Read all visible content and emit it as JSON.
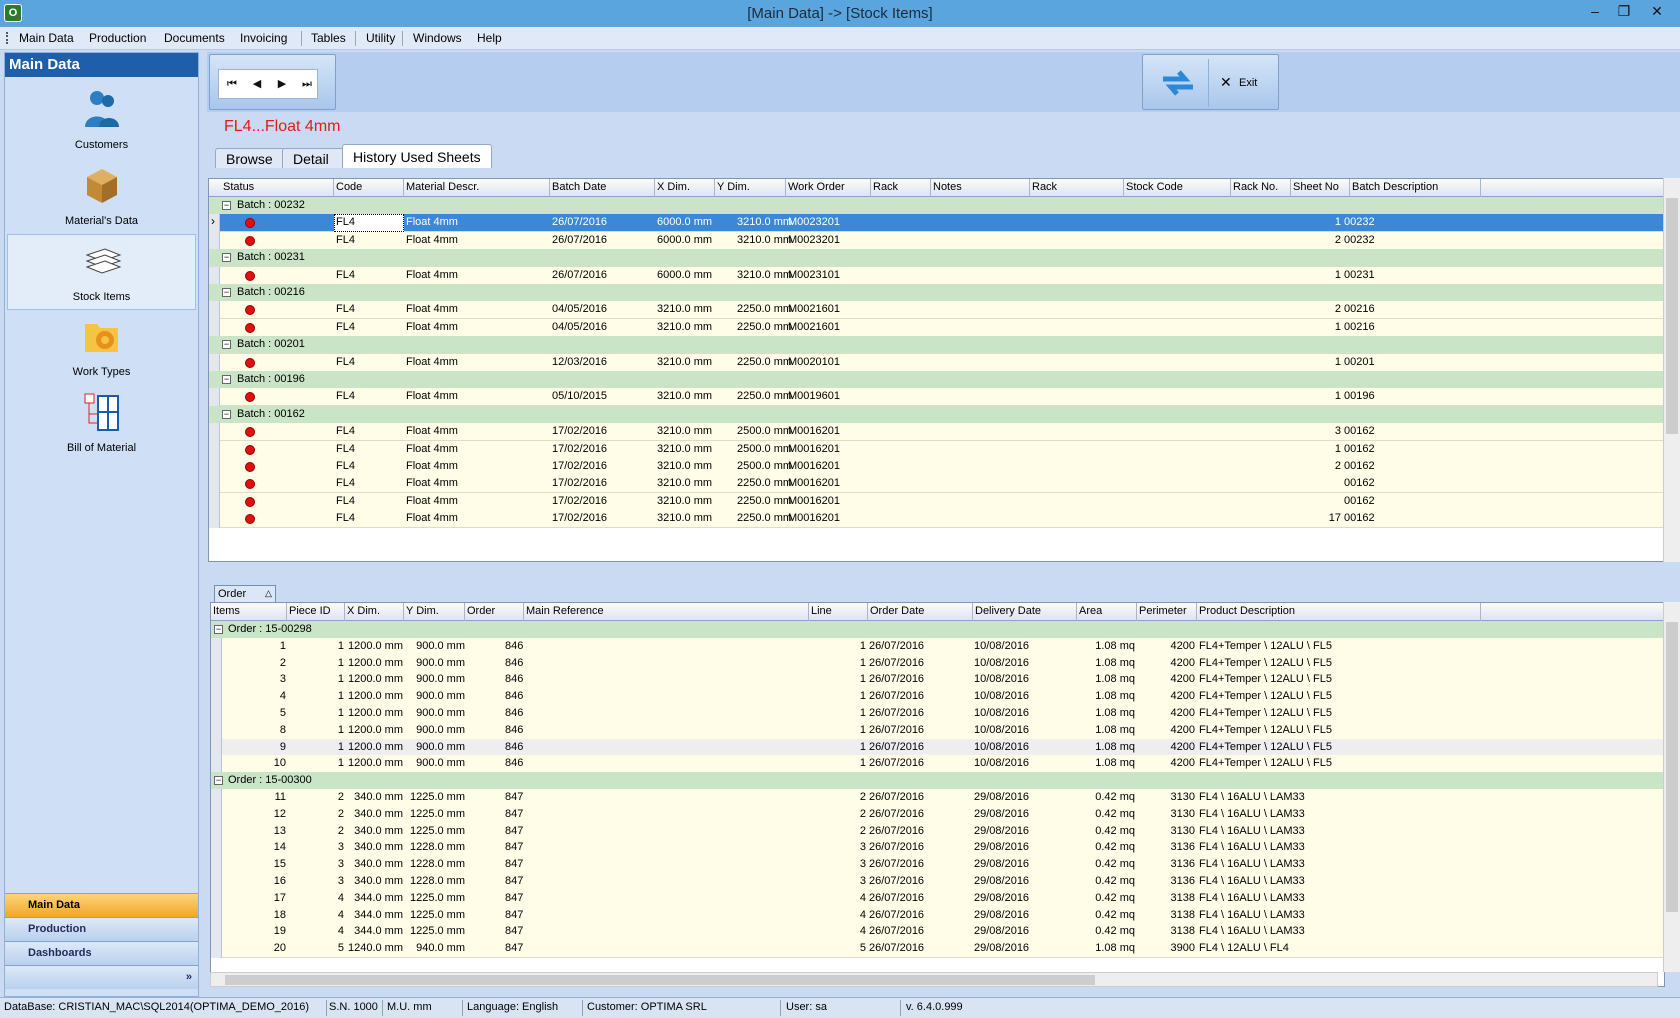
{
  "window": {
    "title": "[Main Data] -> [Stock Items]",
    "app_icon": "optima-app-icon"
  },
  "menu": [
    "Main Data",
    "Production",
    "Documents",
    "Invoicing",
    "Tables",
    "Utility",
    "Windows",
    "Help"
  ],
  "sidebar": {
    "header": "Main Data",
    "items": [
      {
        "label": "Customers",
        "icon": "customers-icon"
      },
      {
        "label": "Material's Data",
        "icon": "box-icon"
      },
      {
        "label": "Stock Items",
        "icon": "sheets-stack-icon"
      },
      {
        "label": "Work Types",
        "icon": "gear-folder-icon"
      },
      {
        "label": "Bill of Material",
        "icon": "bill-of-material-icon"
      }
    ],
    "bottom_tabs": [
      "Main Data",
      "Production",
      "Dashboards"
    ],
    "expand_glyph": "»"
  },
  "toolbar": {
    "exit_label": "Exit"
  },
  "record_title": "FL4...Float 4mm",
  "tabs": [
    "Browse",
    "Detail",
    "History Used Sheets"
  ],
  "grid1": {
    "columns": [
      "Status",
      "Code",
      "Material Descr.",
      "Batch Date",
      "X Dim.",
      "Y Dim.",
      "Work Order",
      "Rack",
      "Notes",
      "Rack",
      "Stock Code",
      "Rack No.",
      "Sheet No",
      "Batch Description"
    ],
    "rows": [
      {
        "group": "Batch : 00232"
      },
      {
        "code": "FL4",
        "descr": "Float 4mm",
        "date": "26/07/2016",
        "x": "6000.0 mm",
        "y": "3210.0 mm",
        "wo": "M0023201",
        "sheet": "1",
        "batch": "00232",
        "selected": true
      },
      {
        "code": "FL4",
        "descr": "Float 4mm",
        "date": "26/07/2016",
        "x": "6000.0 mm",
        "y": "3210.0 mm",
        "wo": "M0023201",
        "sheet": "2",
        "batch": "00232"
      },
      {
        "group": "Batch : 00231"
      },
      {
        "code": "FL4",
        "descr": "Float 4mm",
        "date": "26/07/2016",
        "x": "6000.0 mm",
        "y": "3210.0 mm",
        "wo": "M0023101",
        "sheet": "1",
        "batch": "00231"
      },
      {
        "group": "Batch : 00216"
      },
      {
        "code": "FL4",
        "descr": "Float 4mm",
        "date": "04/05/2016",
        "x": "3210.0 mm",
        "y": "2250.0 mm",
        "wo": "M0021601",
        "sheet": "2",
        "batch": "00216"
      },
      {
        "code": "FL4",
        "descr": "Float 4mm",
        "date": "04/05/2016",
        "x": "3210.0 mm",
        "y": "2250.0 mm",
        "wo": "M0021601",
        "sheet": "1",
        "batch": "00216"
      },
      {
        "group": "Batch : 00201"
      },
      {
        "code": "FL4",
        "descr": "Float 4mm",
        "date": "12/03/2016",
        "x": "3210.0 mm",
        "y": "2250.0 mm",
        "wo": "M0020101",
        "sheet": "1",
        "batch": "00201"
      },
      {
        "group": "Batch : 00196"
      },
      {
        "code": "FL4",
        "descr": "Float 4mm",
        "date": "05/10/2015",
        "x": "3210.0 mm",
        "y": "2250.0 mm",
        "wo": "M0019601",
        "sheet": "1",
        "batch": "00196"
      },
      {
        "group": "Batch : 00162"
      },
      {
        "code": "FL4",
        "descr": "Float 4mm",
        "date": "17/02/2016",
        "x": "3210.0 mm",
        "y": "2500.0 mm",
        "wo": "M0016201",
        "sheet": "3",
        "batch": "00162"
      },
      {
        "code": "FL4",
        "descr": "Float 4mm",
        "date": "17/02/2016",
        "x": "3210.0 mm",
        "y": "2500.0 mm",
        "wo": "M0016201",
        "sheet": "1",
        "batch": "00162"
      },
      {
        "code": "FL4",
        "descr": "Float 4mm",
        "date": "17/02/2016",
        "x": "3210.0 mm",
        "y": "2500.0 mm",
        "wo": "M0016201",
        "sheet": "2",
        "batch": "00162"
      },
      {
        "code": "FL4",
        "descr": "Float 4mm",
        "date": "17/02/2016",
        "x": "3210.0 mm",
        "y": "2250.0 mm",
        "wo": "M0016201",
        "sheet": "",
        "batch": "00162"
      },
      {
        "code": "FL4",
        "descr": "Float 4mm",
        "date": "17/02/2016",
        "x": "3210.0 mm",
        "y": "2250.0 mm",
        "wo": "M0016201",
        "sheet": "",
        "batch": "00162"
      },
      {
        "code": "FL4",
        "descr": "Float 4mm",
        "date": "17/02/2016",
        "x": "3210.0 mm",
        "y": "2250.0 mm",
        "wo": "M0016201",
        "sheet": "17",
        "batch": "00162"
      }
    ]
  },
  "group_by": "Order",
  "grid2": {
    "columns": [
      "Items",
      "Piece ID",
      "X Dim.",
      "Y Dim.",
      "Order",
      "Main Reference",
      "Line",
      "Order Date",
      "Delivery Date",
      "Area",
      "Perimeter",
      "Product Description"
    ],
    "rows": [
      {
        "group": "Order : 15-00298"
      },
      {
        "item": "1",
        "piece": "1",
        "x": "1200.0 mm",
        "y": "900.0 mm",
        "order": "846",
        "line": "1",
        "odate": "26/07/2016",
        "ddate": "10/08/2016",
        "area": "1.08 mq",
        "perim": "4200",
        "prod": "FL4+Temper \\ 12ALU \\ FL5"
      },
      {
        "item": "2",
        "piece": "1",
        "x": "1200.0 mm",
        "y": "900.0 mm",
        "order": "846",
        "line": "1",
        "odate": "26/07/2016",
        "ddate": "10/08/2016",
        "area": "1.08 mq",
        "perim": "4200",
        "prod": "FL4+Temper \\ 12ALU \\ FL5"
      },
      {
        "item": "3",
        "piece": "1",
        "x": "1200.0 mm",
        "y": "900.0 mm",
        "order": "846",
        "line": "1",
        "odate": "26/07/2016",
        "ddate": "10/08/2016",
        "area": "1.08 mq",
        "perim": "4200",
        "prod": "FL4+Temper \\ 12ALU \\ FL5"
      },
      {
        "item": "4",
        "piece": "1",
        "x": "1200.0 mm",
        "y": "900.0 mm",
        "order": "846",
        "line": "1",
        "odate": "26/07/2016",
        "ddate": "10/08/2016",
        "area": "1.08 mq",
        "perim": "4200",
        "prod": "FL4+Temper \\ 12ALU \\ FL5"
      },
      {
        "item": "5",
        "piece": "1",
        "x": "1200.0 mm",
        "y": "900.0 mm",
        "order": "846",
        "line": "1",
        "odate": "26/07/2016",
        "ddate": "10/08/2016",
        "area": "1.08 mq",
        "perim": "4200",
        "prod": "FL4+Temper \\ 12ALU \\ FL5"
      },
      {
        "item": "8",
        "piece": "1",
        "x": "1200.0 mm",
        "y": "900.0 mm",
        "order": "846",
        "line": "1",
        "odate": "26/07/2016",
        "ddate": "10/08/2016",
        "area": "1.08 mq",
        "perim": "4200",
        "prod": "FL4+Temper \\ 12ALU \\ FL5"
      },
      {
        "item": "9",
        "piece": "1",
        "x": "1200.0 mm",
        "y": "900.0 mm",
        "order": "846",
        "line": "1",
        "odate": "26/07/2016",
        "ddate": "10/08/2016",
        "area": "1.08 mq",
        "perim": "4200",
        "prod": "FL4+Temper \\ 12ALU \\ FL5",
        "alt": true
      },
      {
        "item": "10",
        "piece": "1",
        "x": "1200.0 mm",
        "y": "900.0 mm",
        "order": "846",
        "line": "1",
        "odate": "26/07/2016",
        "ddate": "10/08/2016",
        "area": "1.08 mq",
        "perim": "4200",
        "prod": "FL4+Temper \\ 12ALU \\ FL5"
      },
      {
        "group": "Order : 15-00300"
      },
      {
        "item": "11",
        "piece": "2",
        "x": "340.0 mm",
        "y": "1225.0 mm",
        "order": "847",
        "line": "2",
        "odate": "26/07/2016",
        "ddate": "29/08/2016",
        "area": "0.42 mq",
        "perim": "3130",
        "prod": "FL4 \\ 16ALU \\ LAM33"
      },
      {
        "item": "12",
        "piece": "2",
        "x": "340.0 mm",
        "y": "1225.0 mm",
        "order": "847",
        "line": "2",
        "odate": "26/07/2016",
        "ddate": "29/08/2016",
        "area": "0.42 mq",
        "perim": "3130",
        "prod": "FL4 \\ 16ALU \\ LAM33"
      },
      {
        "item": "13",
        "piece": "2",
        "x": "340.0 mm",
        "y": "1225.0 mm",
        "order": "847",
        "line": "2",
        "odate": "26/07/2016",
        "ddate": "29/08/2016",
        "area": "0.42 mq",
        "perim": "3130",
        "prod": "FL4 \\ 16ALU \\ LAM33"
      },
      {
        "item": "14",
        "piece": "3",
        "x": "340.0 mm",
        "y": "1228.0 mm",
        "order": "847",
        "line": "3",
        "odate": "26/07/2016",
        "ddate": "29/08/2016",
        "area": "0.42 mq",
        "perim": "3136",
        "prod": "FL4 \\ 16ALU \\ LAM33"
      },
      {
        "item": "15",
        "piece": "3",
        "x": "340.0 mm",
        "y": "1228.0 mm",
        "order": "847",
        "line": "3",
        "odate": "26/07/2016",
        "ddate": "29/08/2016",
        "area": "0.42 mq",
        "perim": "3136",
        "prod": "FL4 \\ 16ALU \\ LAM33"
      },
      {
        "item": "16",
        "piece": "3",
        "x": "340.0 mm",
        "y": "1228.0 mm",
        "order": "847",
        "line": "3",
        "odate": "26/07/2016",
        "ddate": "29/08/2016",
        "area": "0.42 mq",
        "perim": "3136",
        "prod": "FL4 \\ 16ALU \\ LAM33"
      },
      {
        "item": "17",
        "piece": "4",
        "x": "344.0 mm",
        "y": "1225.0 mm",
        "order": "847",
        "line": "4",
        "odate": "26/07/2016",
        "ddate": "29/08/2016",
        "area": "0.42 mq",
        "perim": "3138",
        "prod": "FL4 \\ 16ALU \\ LAM33"
      },
      {
        "item": "18",
        "piece": "4",
        "x": "344.0 mm",
        "y": "1225.0 mm",
        "order": "847",
        "line": "4",
        "odate": "26/07/2016",
        "ddate": "29/08/2016",
        "area": "0.42 mq",
        "perim": "3138",
        "prod": "FL4 \\ 16ALU \\ LAM33"
      },
      {
        "item": "19",
        "piece": "4",
        "x": "344.0 mm",
        "y": "1225.0 mm",
        "order": "847",
        "line": "4",
        "odate": "26/07/2016",
        "ddate": "29/08/2016",
        "area": "0.42 mq",
        "perim": "3138",
        "prod": "FL4 \\ 16ALU \\ LAM33"
      },
      {
        "item": "20",
        "piece": "5",
        "x": "1240.0 mm",
        "y": "940.0 mm",
        "order": "847",
        "line": "5",
        "odate": "26/07/2016",
        "ddate": "29/08/2016",
        "area": "1.08 mq",
        "perim": "3900",
        "prod": "FL4 \\ 12ALU \\ FL4"
      }
    ]
  },
  "statusbar": {
    "database": "DataBase: CRISTIAN_MAC\\SQL2014(OPTIMA_DEMO_2016)",
    "serial": "S.N. 1000",
    "mu": "M.U. mm",
    "language": "Language: English",
    "customer": "Customer: OPTIMA SRL",
    "user": "User: sa",
    "version": "v. 6.4.0.999"
  }
}
